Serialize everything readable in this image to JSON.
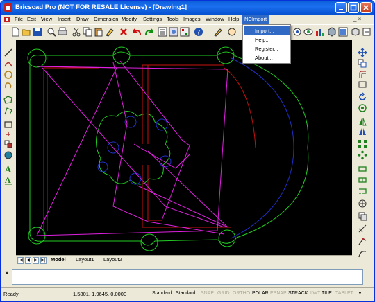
{
  "window": {
    "title": "Bricscad Pro (NOT FOR RESALE License) - [Drawing1]"
  },
  "menu": {
    "items": [
      "File",
      "Edit",
      "View",
      "Insert",
      "Draw",
      "Dimension",
      "Modify",
      "Settings",
      "Tools",
      "Images",
      "Window",
      "Help",
      "NCImport"
    ],
    "active": "NCImport",
    "mdi_controls": "_ ×"
  },
  "dropdown": {
    "items": [
      "Import...",
      "Help...",
      "Register...",
      "About..."
    ],
    "highlighted_index": 0
  },
  "layout_tabs": {
    "nav": [
      "|◀",
      "◀",
      "▶",
      "▶|"
    ],
    "tabs": [
      "Model",
      "Layout1",
      "Layout2"
    ],
    "active": "Model"
  },
  "command": {
    "close_label": "x",
    "value": ""
  },
  "status": {
    "left": "Ready",
    "coords": "1.5801, 1.9645, 0.0000",
    "style1": "Standard",
    "style2": "Standard",
    "toggles": [
      {
        "label": "SNAP",
        "on": false
      },
      {
        "label": "GRID",
        "on": false
      },
      {
        "label": "ORTHO",
        "on": false
      },
      {
        "label": "POLAR",
        "on": true
      },
      {
        "label": "ESNAP",
        "on": false
      },
      {
        "label": "STRACK",
        "on": true
      },
      {
        "label": "LWT",
        "on": false
      },
      {
        "label": "TILE",
        "on": true
      },
      {
        "label": "TABLET",
        "on": false
      }
    ],
    "arrow": "▼"
  },
  "colors": {
    "titlebar": "#0a5fd8",
    "canvas_bg": "#000000",
    "green_entities": "#22cc22",
    "red_entities": "#c81010",
    "magenta_entities": "#e020e0",
    "blue_entities": "#2030c8",
    "menu_highlight": "#316ac5"
  }
}
